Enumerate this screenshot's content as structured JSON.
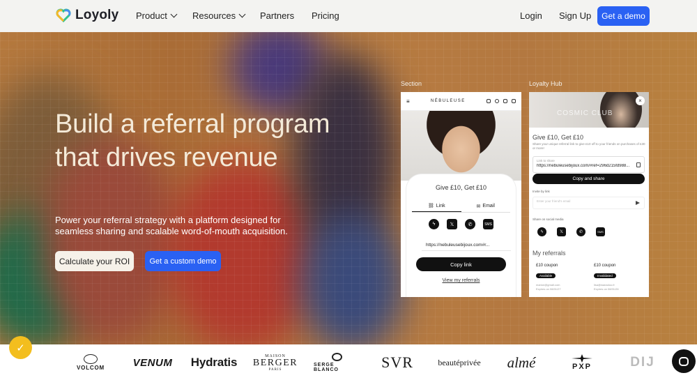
{
  "nav": {
    "logo": "Loyoly",
    "items": [
      {
        "label": "Product",
        "has_menu": true
      },
      {
        "label": "Resources",
        "has_menu": true
      },
      {
        "label": "Partners",
        "has_menu": false
      },
      {
        "label": "Pricing",
        "has_menu": false
      }
    ],
    "login": "Login",
    "signup": "Sign Up",
    "demo": "Get a demo"
  },
  "hero": {
    "title": "Build a referral program that drives revenue",
    "subtitle": "Power your referral strategy with a platform designed for seamless sharing and scalable word-of-mouth acquisition.",
    "btn_roi": "Calculate your ROI",
    "btn_custom": "Get a custom demo"
  },
  "section_card": {
    "label": "Section",
    "brand": "NÉBULEUSE",
    "widget_title": "Give £10, Get £10",
    "tab_link": "Link",
    "tab_email": "Email",
    "socials": [
      "messenger-icon",
      "x-icon",
      "whatsapp-icon",
      "sms-icon"
    ],
    "sms": "SMS",
    "referral_link": "https://nebuleusebijoux.com#r...",
    "copy_btn": "Copy link",
    "view_link": "View my referrals"
  },
  "hub_card": {
    "label": "Loyalty Hub",
    "banner": "COSMIC CLUB",
    "close": "×",
    "title": "Give £10, Get £10",
    "desc": "Share your unique referral link to give £10 off to your friends on purchases of £30 or more!",
    "share_label": "Link to share",
    "share_url": "https://nebuleusebijoux.com/#ref=296d215fd988...",
    "copy_btn": "Copy and share",
    "invite_label": "Invite by link",
    "email_placeholder": "Enter your friend's email",
    "social_label": "Share on social media",
    "sms": "SMS",
    "referrals_title": "My referrals",
    "coupons": [
      {
        "title": "£10 coupon",
        "status": "Available",
        "email": "marion@gmail.com",
        "expiry": "Expires on 08/01/27"
      },
      {
        "title": "£10 coupon",
        "status": "Invalidated",
        "email": "lisa@wanadoo.fr",
        "expiry": "Expires on 08/01/26"
      }
    ]
  },
  "brands": {
    "volcom": "VOLCOM",
    "venum": "VENUM",
    "hydratis": "Hydratis",
    "berger_top": "MAISON",
    "berger": "BERGER",
    "berger_bottom": "PARIS",
    "serge": "SERGE BLANCO",
    "svr": "SVR",
    "beaute": "beautéprivée",
    "alme": "almé",
    "pxp": "PXP",
    "diji": "DIJ"
  },
  "colors": {
    "accent": "#2a61f3",
    "hero_bg": "#b77a3f",
    "badge": "#f3be1e"
  }
}
